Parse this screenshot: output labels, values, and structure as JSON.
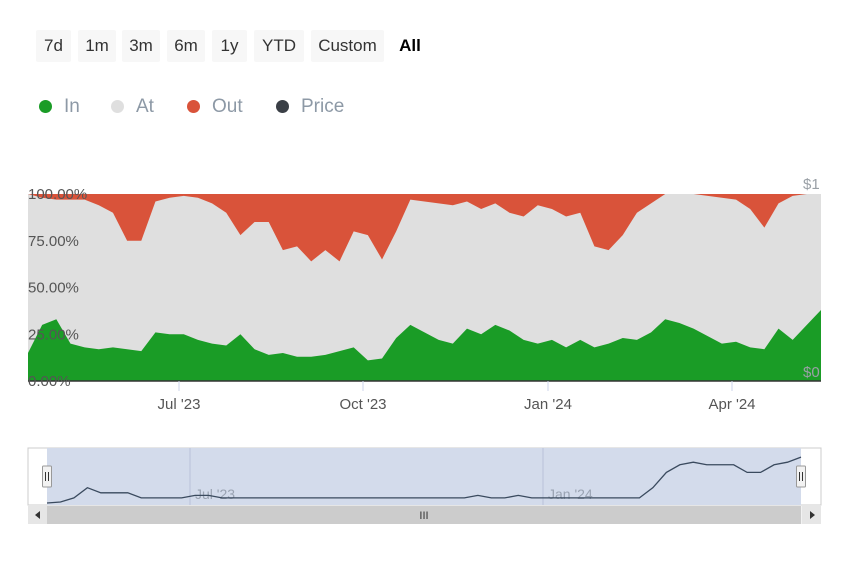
{
  "range_selector": {
    "buttons": [
      "7d",
      "1m",
      "3m",
      "6m",
      "1y",
      "YTD",
      "Custom",
      "All"
    ],
    "active": "All"
  },
  "legend": [
    {
      "label": "In",
      "color": "#1a9c26"
    },
    {
      "label": "At",
      "color": "#dfdfdf"
    },
    {
      "label": "Out",
      "color": "#d9533a"
    },
    {
      "label": "Price",
      "color": "#3a3f46"
    }
  ],
  "chart_data": {
    "type": "area",
    "stacking": "percent",
    "x_start": "2023-04-17",
    "x_step_days": 7,
    "x_ticks": [
      "Jul '23",
      "Oct '23",
      "Jan '24",
      "Apr '24"
    ],
    "y_ticks": [
      "0.00%",
      "25.00%",
      "50.00%",
      "75.00%",
      "100.00%"
    ],
    "ylim": [
      0,
      100
    ],
    "y2_ticks": [
      "$0",
      "$1"
    ],
    "y2lim": [
      0,
      1
    ],
    "series": [
      {
        "name": "In",
        "values": [
          15,
          30,
          33,
          20,
          18,
          17,
          18,
          17,
          16,
          26,
          25,
          25,
          22,
          20,
          19,
          25,
          17,
          14,
          15,
          13,
          13,
          14,
          16,
          18,
          11,
          12,
          23,
          30,
          26,
          22,
          20,
          28,
          25,
          30,
          27,
          22,
          20,
          22,
          18,
          22,
          18,
          20,
          23,
          22,
          26,
          33,
          31,
          28,
          24,
          20,
          21,
          18,
          17,
          28,
          22,
          30,
          38
        ]
      },
      {
        "name": "Out",
        "values": [
          0,
          2,
          3,
          3,
          3,
          6,
          10,
          25,
          25,
          4,
          2,
          1,
          2,
          5,
          10,
          22,
          15,
          15,
          30,
          28,
          36,
          30,
          36,
          20,
          22,
          35,
          20,
          3,
          4,
          5,
          6,
          4,
          8,
          5,
          10,
          12,
          6,
          8,
          12,
          10,
          28,
          30,
          22,
          10,
          5,
          0,
          0,
          0,
          1,
          2,
          3,
          8,
          18,
          5,
          1,
          0,
          0
        ]
      },
      {
        "name": "Price",
        "values": [
          0,
          0.02,
          0.1,
          0.3,
          0.2,
          0.2,
          0.2,
          0.1,
          0.1,
          0.1,
          0.1,
          0.15,
          0.15,
          0.1,
          0.1,
          0.1,
          0.1,
          0.1,
          0.1,
          0.1,
          0.1,
          0.1,
          0.1,
          0.1,
          0.1,
          0.1,
          0.1,
          0.1,
          0.1,
          0.1,
          0.1,
          0.1,
          0.15,
          0.1,
          0.1,
          0.15,
          0.1,
          0.1,
          0.1,
          0.1,
          0.1,
          0.1,
          0.1,
          0.1,
          0.1,
          0.3,
          0.6,
          0.75,
          0.8,
          0.75,
          0.75,
          0.75,
          0.6,
          0.6,
          0.75,
          0.8,
          0.9
        ]
      }
    ],
    "navigator": {
      "x_ticks": [
        "Jul '23",
        "Jan '24"
      ],
      "scrollbar_grip": "III"
    }
  }
}
